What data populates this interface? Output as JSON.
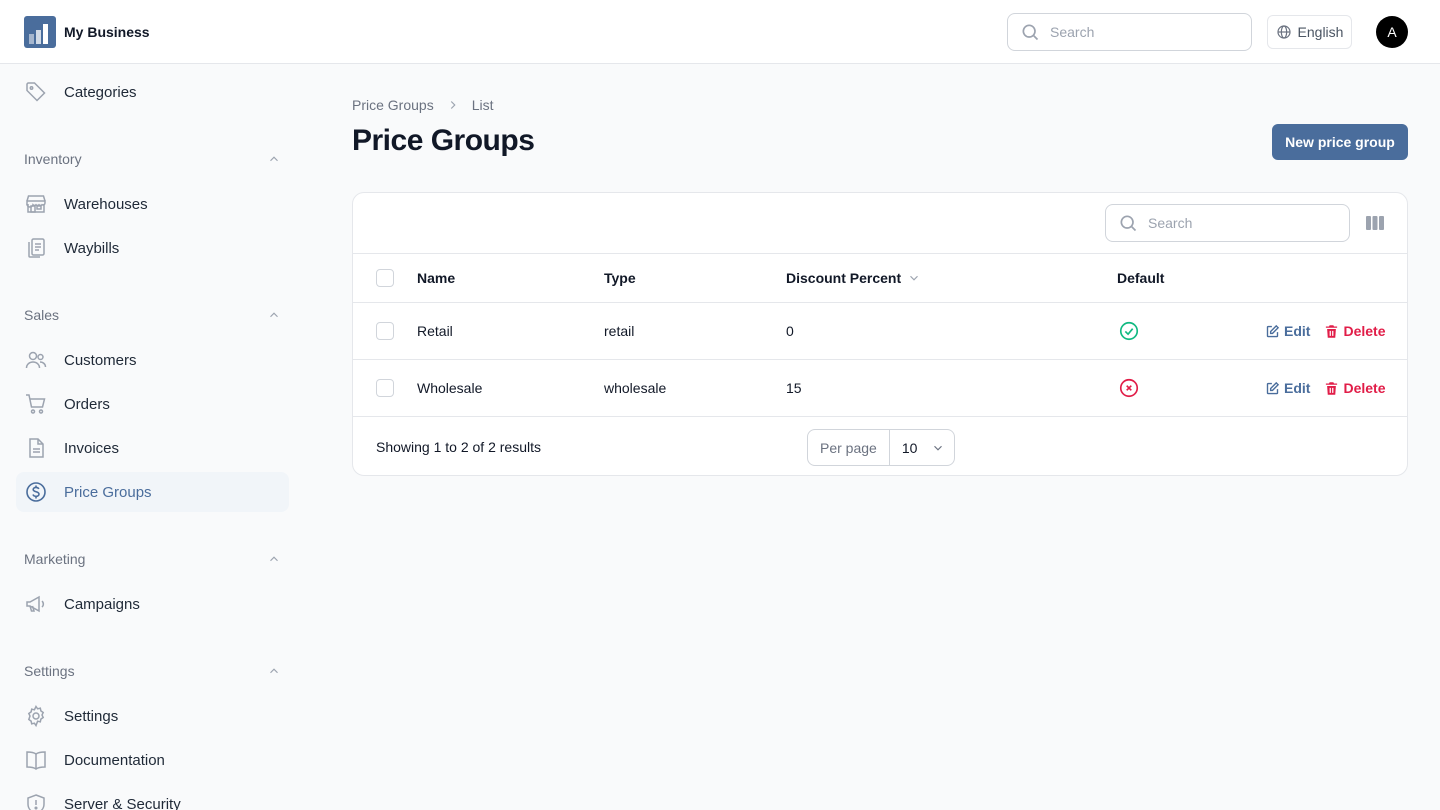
{
  "header": {
    "brand": "My Business",
    "search_placeholder": "Search",
    "language": "English",
    "avatar_initial": "A"
  },
  "sidebar": {
    "top_items": [
      {
        "label": "Categories",
        "icon": "tag-icon"
      }
    ],
    "groups": [
      {
        "label": "Inventory",
        "items": [
          {
            "label": "Warehouses",
            "icon": "warehouse-icon"
          },
          {
            "label": "Waybills",
            "icon": "clipboard-icon"
          }
        ]
      },
      {
        "label": "Sales",
        "items": [
          {
            "label": "Customers",
            "icon": "users-icon"
          },
          {
            "label": "Orders",
            "icon": "cart-icon"
          },
          {
            "label": "Invoices",
            "icon": "document-icon"
          },
          {
            "label": "Price Groups",
            "icon": "dollar-circle-icon",
            "active": true
          }
        ]
      },
      {
        "label": "Marketing",
        "items": [
          {
            "label": "Campaigns",
            "icon": "megaphone-icon"
          }
        ]
      },
      {
        "label": "Settings",
        "items": [
          {
            "label": "Settings",
            "icon": "gear-icon"
          },
          {
            "label": "Documentation",
            "icon": "book-icon"
          },
          {
            "label": "Server & Security",
            "icon": "shield-icon"
          }
        ]
      }
    ]
  },
  "breadcrumb": [
    "Price Groups",
    "List"
  ],
  "page": {
    "title": "Price Groups",
    "new_button": "New price group"
  },
  "table": {
    "search_placeholder": "Search",
    "columns": [
      "Name",
      "Type",
      "Discount Percent",
      "Default"
    ],
    "rows": [
      {
        "name": "Retail",
        "type": "retail",
        "discount": "0",
        "default": true
      },
      {
        "name": "Wholesale",
        "type": "wholesale",
        "discount": "15",
        "default": false
      }
    ],
    "edit_label": "Edit",
    "delete_label": "Delete",
    "summary": "Showing 1 to 2 of 2 results",
    "per_page_label": "Per page",
    "per_page_value": "10"
  },
  "colors": {
    "accent": "#4a6d9c",
    "danger": "#e11d48",
    "success": "#10b981"
  }
}
